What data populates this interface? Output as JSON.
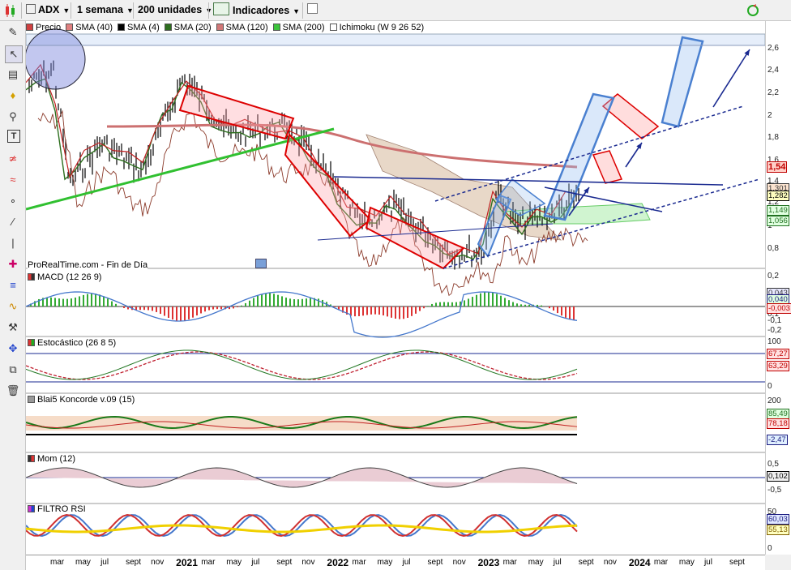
{
  "toolbar": {
    "symbol": "ADX",
    "period": "1 semana",
    "units": "200 unidades",
    "indicators": "Indicadores"
  },
  "legend": [
    {
      "label": "Precio",
      "color": "#d04040"
    },
    {
      "label": "SMA (40)",
      "color": "#e08080"
    },
    {
      "label": "SMA (4)",
      "color": "#000000"
    },
    {
      "label": "SMA (20)",
      "color": "#2d6e1e"
    },
    {
      "label": "SMA (120)",
      "color": "#d27878"
    },
    {
      "label": "SMA (200)",
      "color": "#3cc43c"
    },
    {
      "label": "Ichimoku (W 9 26 52)",
      "color": "#ffffff"
    }
  ],
  "watermark": "ProRealTime.com - Fin de Día",
  "panels": {
    "macd": "MACD (12 26 9)",
    "stoch": "Estocástico (26 8 5)",
    "koncorde": "Blai5 Koncorde v.09 (15)",
    "mom": "Mom (12)",
    "rsi": "FILTRO RSI"
  },
  "price_axis": [
    "2,6",
    "2,4",
    "2,2",
    "2",
    "1,8",
    "1,6",
    "1,4",
    "1,2",
    "1",
    "0,8"
  ],
  "price_tags": [
    {
      "text": "1,54",
      "bg": "#ffd0c8",
      "color": "#c00000"
    },
    {
      "text": "1,301",
      "bg": "#fce4d0",
      "color": "#333333"
    },
    {
      "text": "1,282",
      "bg": "#ffffc0",
      "color": "#000000"
    },
    {
      "text": "1,149",
      "bg": "#e0ffe0",
      "color": "#207020"
    },
    {
      "text": "1,056",
      "bg": "#e0ffe0",
      "color": "#207020"
    }
  ],
  "macd_axis": [
    "0,2",
    "0,1",
    "-0,1",
    "-0,2"
  ],
  "macd_tags": [
    {
      "text": "0,043",
      "bg": "#e8e8ff",
      "color": "#333333"
    },
    {
      "text": "0,040",
      "bg": "#e0ffe0",
      "color": "#1a1a80"
    },
    {
      "text": "-0,003",
      "bg": "#ffe0e0",
      "color": "#c00000"
    }
  ],
  "stoch_axis": [
    "100",
    "0"
  ],
  "stoch_tags": [
    {
      "text": "67,27",
      "bg": "#ffe0e0",
      "color": "#c00000"
    },
    {
      "text": "63,29",
      "bg": "#ffe0e0",
      "color": "#c00000"
    }
  ],
  "konc_axis": [
    "200",
    "100"
  ],
  "konc_tags": [
    {
      "text": "85,49",
      "bg": "#e0ffe0",
      "color": "#207020"
    },
    {
      "text": "78,18",
      "bg": "#ffe0e0",
      "color": "#c00000"
    },
    {
      "text": "-2,47",
      "bg": "#e0f0ff",
      "color": "#1a1a80"
    }
  ],
  "mom_axis": [
    "0,5",
    "-0,5"
  ],
  "mom_tags": [
    {
      "text": "0,102",
      "bg": "#f0f0f0",
      "color": "#000000"
    }
  ],
  "rsi_axis": [
    "50",
    "0"
  ],
  "rsi_tags": [
    {
      "text": "60,03",
      "bg": "#e0e8ff",
      "color": "#1a1a80"
    },
    {
      "text": "55,13",
      "bg": "#ffffc0",
      "color": "#806000"
    }
  ],
  "x_axis": [
    {
      "t": "mar",
      "b": false
    },
    {
      "t": "may",
      "b": false
    },
    {
      "t": "jul",
      "b": false
    },
    {
      "t": "sept",
      "b": false
    },
    {
      "t": "nov",
      "b": false
    },
    {
      "t": "2021",
      "b": true
    },
    {
      "t": "mar",
      "b": false
    },
    {
      "t": "may",
      "b": false
    },
    {
      "t": "jul",
      "b": false
    },
    {
      "t": "sept",
      "b": false
    },
    {
      "t": "nov",
      "b": false
    },
    {
      "t": "2022",
      "b": true
    },
    {
      "t": "mar",
      "b": false
    },
    {
      "t": "may",
      "b": false
    },
    {
      "t": "jul",
      "b": false
    },
    {
      "t": "sept",
      "b": false
    },
    {
      "t": "nov",
      "b": false
    },
    {
      "t": "2023",
      "b": true
    },
    {
      "t": "mar",
      "b": false
    },
    {
      "t": "may",
      "b": false
    },
    {
      "t": "jul",
      "b": false
    },
    {
      "t": "sept",
      "b": false
    },
    {
      "t": "nov",
      "b": false
    },
    {
      "t": "2024",
      "b": true
    },
    {
      "t": "mar",
      "b": false
    },
    {
      "t": "may",
      "b": false
    },
    {
      "t": "jul",
      "b": false
    },
    {
      "t": "sept",
      "b": false
    }
  ],
  "tools": [
    "pencil-icon",
    "cursor-icon",
    "ruler-icon",
    "alarm-icon",
    "zoom-icon",
    "text-icon",
    "trend-icon",
    "channel-icon",
    "node-icon",
    "line-icon",
    "vertical-line-icon",
    "fibonacci-icon",
    "horizontal-line-icon",
    "wave-icon",
    "tools-icon",
    "move-icon",
    "copy-icon",
    "trash-icon"
  ]
}
